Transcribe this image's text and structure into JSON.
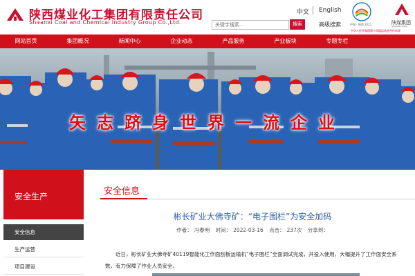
{
  "header": {
    "brand_cn": "陕西煤业化工集团有限责任公司",
    "brand_en": "Shaanxi Coal and Chemical Industry Group Co.,Ltd.",
    "lang_cn": "中文",
    "lang_en": "English",
    "search_placeholder": "关键字搜索...",
    "search_button": "搜索",
    "advanced_search": "高级搜索",
    "emblem1_caption": "中国 · 陕西 2021",
    "emblem2_caption": "陕煤集团",
    "emblem2_en": "SHAANXI COAL",
    "sponsor_text": "中华人民共和国第十四届运动会合作伙伴"
  },
  "nav": {
    "items": [
      "网站首页",
      "集团概况",
      "新闻中心",
      "企业动态",
      "产品服务",
      "产业板块",
      "专题专栏"
    ]
  },
  "banner": {
    "slogan": "矢志跻身世界一流企业"
  },
  "sidebar": {
    "title": "安全生产",
    "items": [
      {
        "label": "安全信息",
        "active": true
      },
      {
        "label": "生产运营",
        "active": false
      },
      {
        "label": "项目建设",
        "active": false
      }
    ]
  },
  "content": {
    "section_title": "安全信息",
    "article_title": "彬长矿业大佛寺矿：“电子围栏”为安全加码",
    "meta": {
      "author_label": "作者：",
      "author": "冯春明",
      "time_label": "时间：",
      "time": "2022-03-16",
      "clicks_label": "点击：",
      "clicks": "237次",
      "share_label": "分享到："
    },
    "body": "近日，彬长矿业大佛寺矿40119智能化工作面刮板运输机“电子围栏”全面调试完成，并投入使用，大幅提升了工作面安全系数，有力保障了作业人员安全。"
  },
  "colors": {
    "brand_red": "#d0111b",
    "title_blue": "#2b5fa8",
    "sidebar_active": "#444444"
  }
}
